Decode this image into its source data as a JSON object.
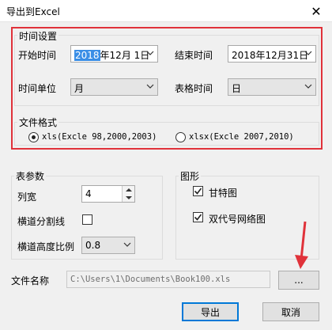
{
  "window": {
    "title": "导出到Excel",
    "close_glyph": "✕"
  },
  "time_settings": {
    "group_title": "时间设置",
    "start_label": "开始时间",
    "start_year_selected": "2018",
    "start_rest": "年12月 1日",
    "end_label": "结束时间",
    "end_value": "2018年12月31日",
    "unit_label": "时间单位",
    "unit_value": "月",
    "table_time_label": "表格时间",
    "table_time_value": "日"
  },
  "file_format": {
    "group_title": "文件格式",
    "xls_label": "xls(Excle 98,2000,2003)",
    "xlsx_label": "xlsx(Excle 2007,2010)",
    "selected": "xls"
  },
  "table_params": {
    "group_title": "表参数",
    "col_width_label": "列宽",
    "col_width_value": "4",
    "lane_divider_label": "横道分割线",
    "lane_divider_checked": false,
    "lane_height_label": "横道高度比例",
    "lane_height_value": "0.8"
  },
  "graphics": {
    "group_title": "图形",
    "gantt_label": "甘特图",
    "gantt_checked": true,
    "network_label": "双代号网络图",
    "network_checked": true
  },
  "file": {
    "label": "文件名称",
    "path": "C:\\Users\\1\\Documents\\Book100.xls",
    "browse_label": "..."
  },
  "actions": {
    "export_label": "导出",
    "cancel_label": "取消"
  },
  "colors": {
    "highlight_box": "#e0323a",
    "annotation_arrow": "#e0323a",
    "selection": "#3a8ee6"
  }
}
